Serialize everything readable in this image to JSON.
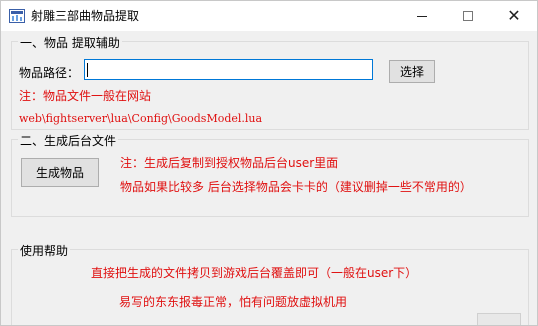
{
  "window": {
    "title": "射雕三部曲物品提取",
    "icon": "app-icon",
    "minimize_icon": "minimize-icon",
    "maximize_icon": "maximize-icon",
    "close_icon": "close-icon",
    "close_glyph": "✕"
  },
  "group1": {
    "legend": "一、物品 提取辅助",
    "path_label": "物品路径：",
    "path_value": "",
    "browse_button": "选择",
    "note1": "注：物品文件一般在网站",
    "note2": "web\\fightserver\\lua\\Config\\GoodsModel.lua"
  },
  "group2": {
    "legend": "二、生成后台文件",
    "generate_button": "生成物品",
    "note1": "注：生成后复制到授权物品后台user里面",
    "note2": "物品如果比较多 后台选择物品会卡卡的（建议删掉一些不常用的）"
  },
  "group3": {
    "legend": "使用帮助",
    "help1": "直接把生成的文件拷贝到游戏后台覆盖即可（一般在user下）",
    "help2": "易写的东东报毒正常，怕有问题放虚拟机用"
  },
  "colors": {
    "note_red": "#e01010",
    "focus_blue": "#0078d7",
    "window_bg": "#f0f0f0"
  }
}
